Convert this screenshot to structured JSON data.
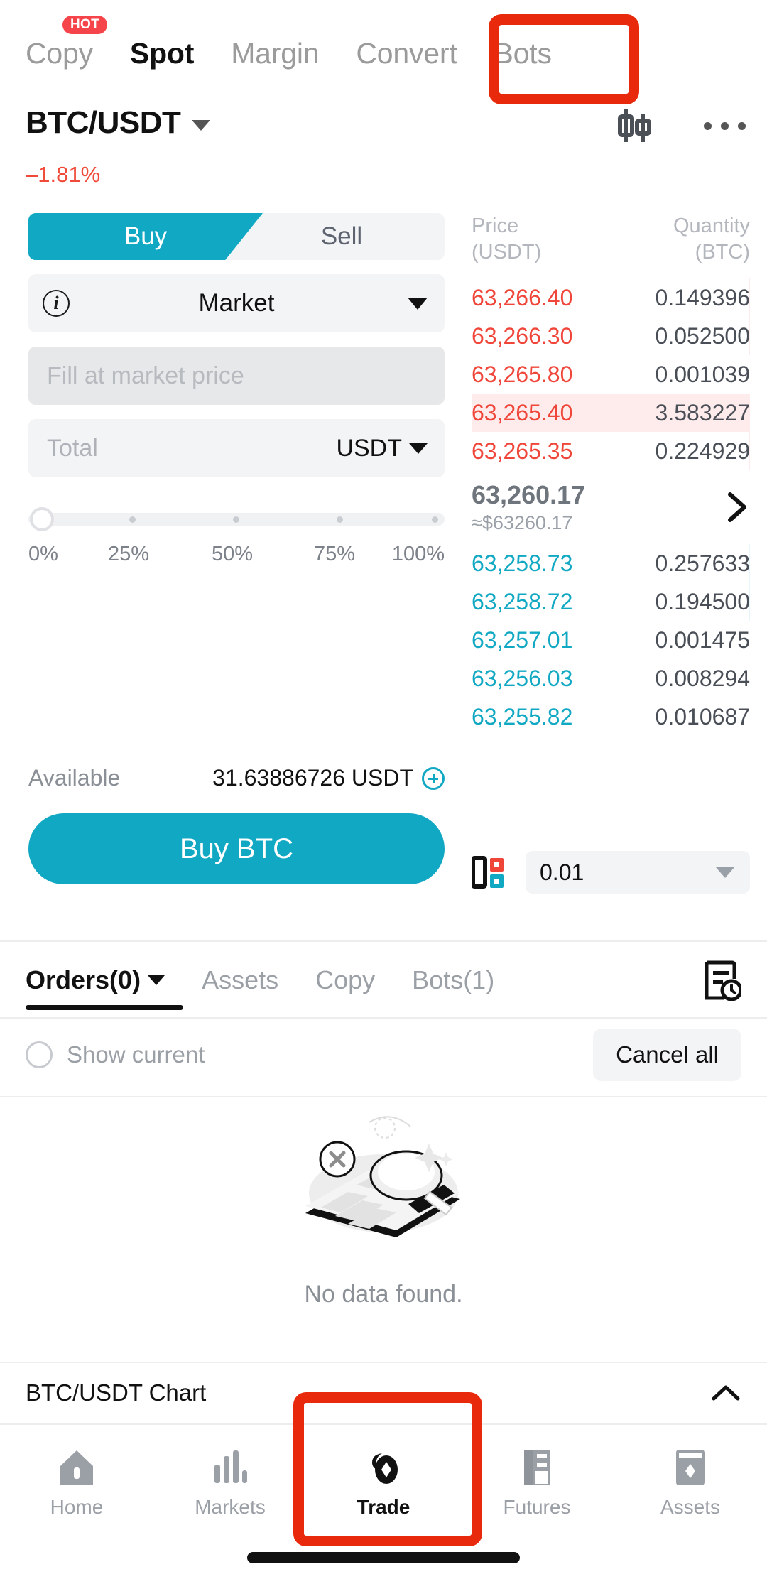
{
  "top_tabs": [
    {
      "label": "Copy",
      "badge": "HOT",
      "active": false
    },
    {
      "label": "Spot",
      "active": true
    },
    {
      "label": "Margin",
      "active": false
    },
    {
      "label": "Convert",
      "active": false
    },
    {
      "label": "Bots",
      "active": false
    }
  ],
  "header": {
    "pair": "BTC/USDT",
    "change_pct": "–1.81%",
    "change_color": "#f04b39",
    "candles_icon": "candlestick-chart-icon",
    "more_icon": "more-options-icon"
  },
  "order_form": {
    "side_buy": "Buy",
    "side_sell": "Sell",
    "active_side": "Buy",
    "order_type": "Market",
    "info_icon": "info-icon",
    "price_placeholder": "Fill at market price",
    "price_value": "",
    "total_placeholder": "Total",
    "total_value": "",
    "total_currency": "USDT",
    "slider_value": 0,
    "slider_ticks": [
      "0%",
      "25%",
      "50%",
      "75%",
      "100%"
    ],
    "available_label": "Available",
    "available_value": "31.63886726 USDT",
    "add_funds_icon": "plus-circle-icon",
    "submit_label": "Buy BTC"
  },
  "order_book": {
    "col_price": "Price",
    "col_price_unit": "(USDT)",
    "col_qty": "Quantity",
    "col_qty_unit": "(BTC)",
    "asks": [
      {
        "price": "63,266.40",
        "qty": "0.149396",
        "depth": 4
      },
      {
        "price": "63,266.30",
        "qty": "0.052500",
        "depth": 3
      },
      {
        "price": "63,265.80",
        "qty": "0.001039",
        "depth": 1
      },
      {
        "price": "63,265.40",
        "qty": "3.583227",
        "depth": 100,
        "highlight": true
      },
      {
        "price": "63,265.35",
        "qty": "0.224929",
        "depth": 9
      }
    ],
    "mid_price": "63,260.17",
    "mid_price_usd": "≈$63260.17",
    "mid_arrow_icon": "chevron-right-icon",
    "bids": [
      {
        "price": "63,258.73",
        "qty": "0.257633",
        "depth": 8
      },
      {
        "price": "63,258.72",
        "qty": "0.194500",
        "depth": 6
      },
      {
        "price": "63,257.01",
        "qty": "0.001475",
        "depth": 1
      },
      {
        "price": "63,256.03",
        "qty": "0.008294",
        "depth": 2
      },
      {
        "price": "63,255.82",
        "qty": "0.010687",
        "depth": 2
      }
    ],
    "precision_icon": "depth-view-icon",
    "precision_value": "0.01"
  },
  "orders_section": {
    "tabs": [
      {
        "label": "Orders(0)",
        "active": true,
        "has_caret": true
      },
      {
        "label": "Assets",
        "active": false
      },
      {
        "label": "Copy",
        "active": false
      },
      {
        "label": "Bots(1)",
        "active": false
      }
    ],
    "history_icon": "order-history-icon",
    "show_current_label": "Show current",
    "show_current_checked": false,
    "cancel_all_label": "Cancel all",
    "empty_text": "No data found.",
    "empty_illustration": "no-data-magnifier-icon"
  },
  "chart_bar": {
    "label": "BTC/USDT  Chart",
    "collapse_icon": "chevron-up-icon"
  },
  "bottom_nav": [
    {
      "label": "Home",
      "icon": "home-icon",
      "active": false
    },
    {
      "label": "Markets",
      "icon": "markets-bars-icon",
      "active": false
    },
    {
      "label": "Trade",
      "icon": "trade-icon",
      "active": true
    },
    {
      "label": "Futures",
      "icon": "futures-icon",
      "active": false
    },
    {
      "label": "Assets",
      "icon": "assets-wallet-icon",
      "active": false
    }
  ],
  "annotations": {
    "highlight_color": "#e8290b",
    "boxes": [
      "bots-tab-highlight",
      "trade-nav-highlight"
    ]
  }
}
